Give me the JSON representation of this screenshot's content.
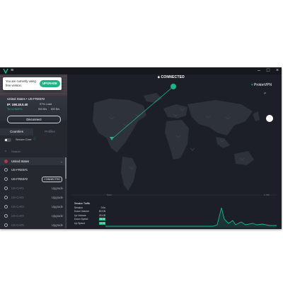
{
  "titlebar": {
    "menu_icon": "hamburger-icon",
    "minimize": "–",
    "maximize": "□",
    "close": "×"
  },
  "popup": {
    "text": "You are currently using free version.",
    "upgrade": "UPGRADE"
  },
  "server": {
    "name": "United States • US-FREE#2",
    "ip": "IP: 198.18.0.40",
    "load": "97% Load",
    "stats": {
      "proto": "Tel on NetFlix",
      "down": "500 B/s",
      "up": "600 B/s"
    },
    "disconnect": "Disconnect"
  },
  "tabs": {
    "countries": "Countries",
    "profiles": "Profiles"
  },
  "secure_core": "Secure Core",
  "search": {
    "placeholder": "Search"
  },
  "countries": [
    {
      "name": "United States",
      "action": ""
    },
    {
      "name": "US-FREE#1",
      "action": ""
    },
    {
      "name": "US-FREE#2",
      "action": "CONNECTED"
    },
    {
      "name": "US-CA#1",
      "action": "Upgrade"
    },
    {
      "name": "US-CA#2",
      "action": "Upgrade"
    },
    {
      "name": "US-CA#3",
      "action": "Upgrade"
    },
    {
      "name": "US-CA#4",
      "action": "Upgrade"
    },
    {
      "name": "US-CA#5",
      "action": "Upgrade"
    }
  ],
  "main": {
    "connected_label": "CONNECTED",
    "brand": "ProtonVPN",
    "profile": "P",
    "graph_left": "Now",
    "graph_right": "1 min",
    "graph_rows": [
      {
        "label": "Session Traffic",
        "value": ""
      },
      {
        "label": "Session",
        "value": "0:0s"
      },
      {
        "label": "Down Volume",
        "value": "83 KB"
      },
      {
        "label": "Up Volume",
        "value": "25 KB"
      },
      {
        "label": "Down Speed",
        "value": "50 B"
      },
      {
        "label": "Up Speed",
        "value": "13 B"
      }
    ]
  },
  "colors": {
    "accent": "#1db585",
    "bg": "#1c1f27",
    "sidebar": "#25282f"
  }
}
